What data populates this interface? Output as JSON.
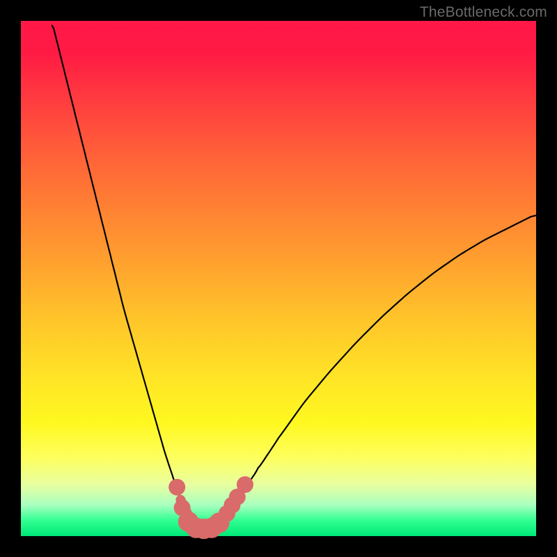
{
  "watermark": "TheBottleneck.com",
  "colors": {
    "curve_stroke": "#000000",
    "marker_fill": "#d96b6b",
    "marker_stroke": "#d96b6b"
  },
  "chart_data": {
    "type": "line",
    "title": "",
    "xlabel": "",
    "ylabel": "",
    "xlim": [
      0,
      100
    ],
    "ylim": [
      0,
      100
    ],
    "grid": false,
    "legend": false,
    "series": [
      {
        "name": "bottleneck-curve",
        "x": [
          6,
          8,
          10,
          12,
          14,
          16,
          18,
          20,
          22,
          24,
          26,
          28,
          30,
          31,
          32,
          33,
          34,
          35,
          36,
          37,
          38,
          39,
          40,
          42,
          44,
          46,
          50,
          55,
          60,
          65,
          70,
          75,
          80,
          85,
          90,
          95,
          100
        ],
        "y": [
          100,
          92,
          84,
          76,
          68,
          60,
          52,
          44,
          37,
          30,
          23,
          16,
          10,
          7,
          5,
          3,
          2,
          1.5,
          1.3,
          1.5,
          2,
          3,
          4.5,
          7,
          10,
          13,
          19,
          26,
          32,
          37.5,
          42.5,
          47,
          51,
          54.5,
          57.5,
          60,
          62.5
        ]
      }
    ],
    "markers": [
      {
        "x": 30.3,
        "y": 9.5,
        "r": 1.2
      },
      {
        "x": 31.3,
        "y": 5.5,
        "r": 1.2
      },
      {
        "x": 32.5,
        "y": 2.8,
        "r": 1.6
      },
      {
        "x": 34.0,
        "y": 1.6,
        "r": 1.6
      },
      {
        "x": 35.5,
        "y": 1.4,
        "r": 1.6
      },
      {
        "x": 37.0,
        "y": 1.6,
        "r": 1.6
      },
      {
        "x": 38.5,
        "y": 2.6,
        "r": 1.6
      },
      {
        "x": 40.0,
        "y": 4.4,
        "r": 1.2
      },
      {
        "x": 41.0,
        "y": 6.0,
        "r": 1.2
      },
      {
        "x": 42.0,
        "y": 7.6,
        "r": 1.2
      },
      {
        "x": 43.5,
        "y": 10.0,
        "r": 1.2
      }
    ],
    "thick_segment": {
      "from_x": 31.0,
      "to_x": 39.5
    }
  }
}
